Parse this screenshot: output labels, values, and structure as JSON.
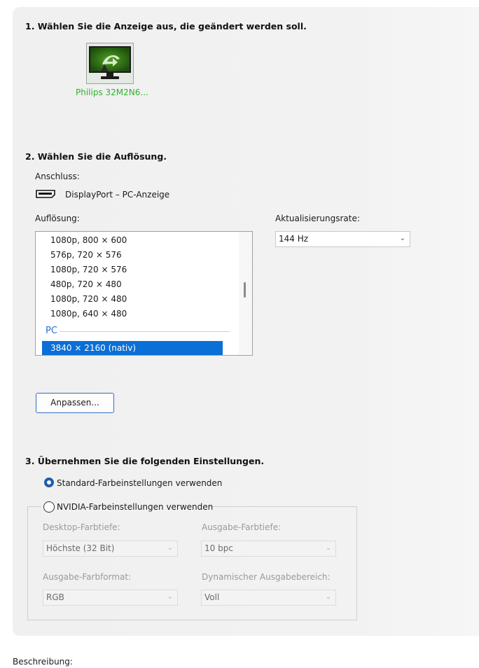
{
  "section1": {
    "heading": "1. Wählen Sie die Anzeige aus, die geändert werden soll.",
    "monitor": {
      "name": "Philips 32M2N6...",
      "icon": "nvidia-monitor-icon"
    }
  },
  "section2": {
    "heading": "2. Wählen Sie die Auflösung.",
    "connection_label": "Anschluss:",
    "connection_value": "DisplayPort – PC-Anzeige",
    "connection_icon": "displayport-connector-icon",
    "resolution_label": "Auflösung:",
    "resolutions": [
      "1080p, 800 × 600",
      "576p, 720 × 576",
      "1080p, 720 × 576",
      "480p, 720 × 480",
      "1080p, 720 × 480",
      "1080p, 640 × 480"
    ],
    "group_pc": "PC",
    "selected_resolution": "3840 × 2160 (nativ)",
    "refresh_label": "Aktualisierungsrate:",
    "refresh_value": "144 Hz",
    "customize_button": "Anpassen..."
  },
  "section3": {
    "heading": "3. Übernehmen Sie die folgenden Einstellungen.",
    "radio_default": "Standard-Farbeinstellungen verwenden",
    "radio_nvidia": "NVIDIA-Farbeinstellungen verwenden",
    "selected": "default",
    "desktop_depth_label": "Desktop-Farbtiefe:",
    "desktop_depth_value": "Höchste (32 Bit)",
    "output_depth_label": "Ausgabe-Farbtiefe:",
    "output_depth_value": "10 bpc",
    "output_format_label": "Ausgabe-Farbformat:",
    "output_format_value": "RGB",
    "dynamic_range_label": "Dynamischer Ausgabebereich:",
    "dynamic_range_value": "Voll"
  },
  "description_label": "Beschreibung:",
  "colors": {
    "accent": "#0a6fd6",
    "nvidia_green": "#76b900",
    "monitor_label": "#2bb42b"
  }
}
